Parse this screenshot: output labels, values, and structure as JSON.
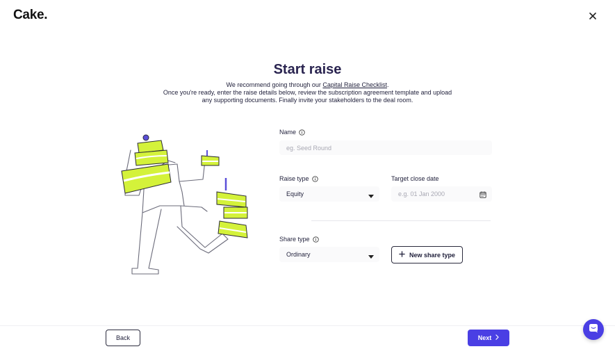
{
  "app": {
    "logo_text": "Cake."
  },
  "header": {
    "close_icon": "close-icon"
  },
  "page": {
    "title": "Start raise",
    "intro_pre": "We recommend going through our ",
    "intro_link": "Capital Raise Checklist",
    "intro_post": ".",
    "intro_line2": "Once you're ready, enter the raise details below, review the subscription agreement template and upload",
    "intro_line3": "any supporting documents. Finally invite your stakeholders to the deal room."
  },
  "form": {
    "name": {
      "label": "Name",
      "placeholder": "eg. Seed Round",
      "value": ""
    },
    "raise_type": {
      "label": "Raise type",
      "value": "Equity"
    },
    "target_close_date": {
      "label": "Target close date",
      "placeholder": "e.g. 01 Jan 2000",
      "value": ""
    },
    "share_type": {
      "label": "Share type",
      "value": "Ordinary"
    },
    "new_share_type_label": "New share type"
  },
  "footer": {
    "back_label": "Back",
    "next_label": "Next"
  },
  "colors": {
    "primary": "#4a3fe4",
    "cake_green": "#d4f23a",
    "title": "#2a2450"
  },
  "icons": {
    "info": "info-icon",
    "caret": "caret-down-icon",
    "calendar": "calendar-icon",
    "plus": "plus-icon",
    "chevron": "chevron-right-icon",
    "chat": "chat-icon"
  }
}
